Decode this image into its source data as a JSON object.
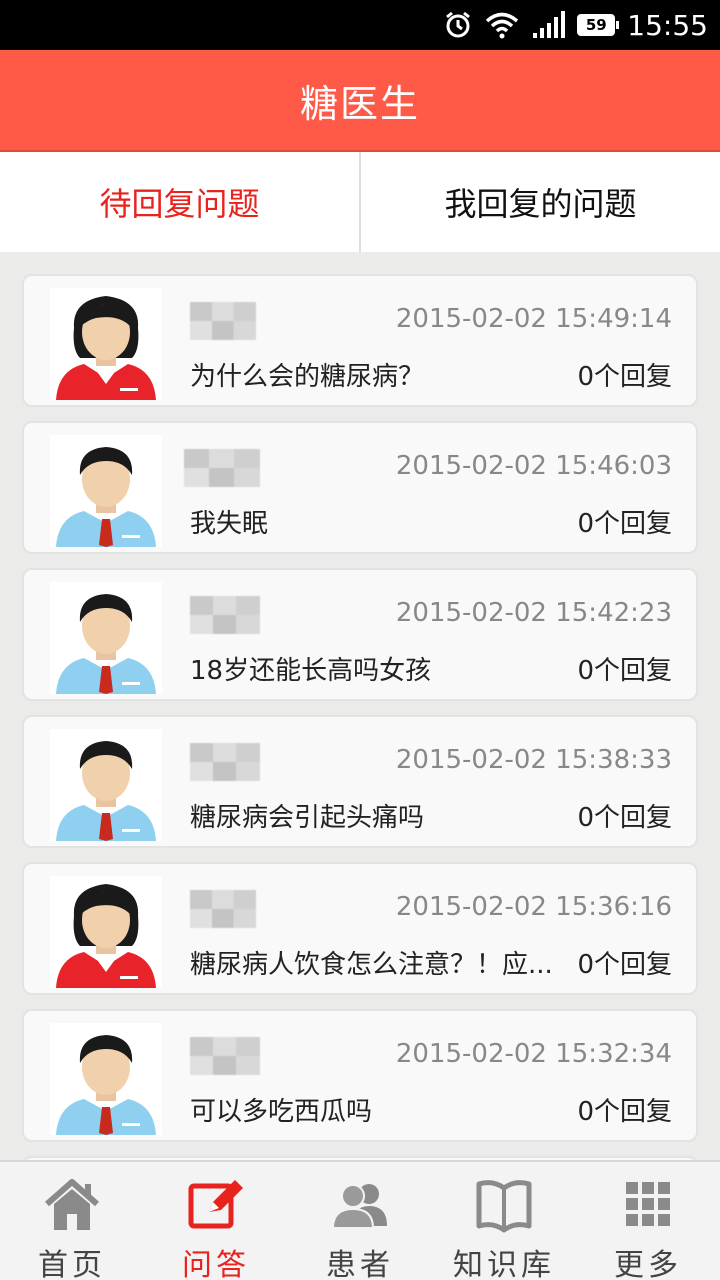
{
  "status_bar": {
    "time": "15:55",
    "battery": "59",
    "icons": [
      "alarm-icon",
      "wifi-icon",
      "signal-icon",
      "battery-icon"
    ]
  },
  "header": {
    "title": "糖医生"
  },
  "tabs": [
    {
      "label": "待回复问题",
      "active": true
    },
    {
      "label": "我回复的问题",
      "active": false
    }
  ],
  "questions": [
    {
      "avatar": "female-avatar-icon",
      "time": "2015-02-02 15:49:14",
      "text": "为什么会的糖尿病？",
      "replies": "0个回复"
    },
    {
      "avatar": "male-avatar-icon",
      "time": "2015-02-02 15:46:03",
      "text": "我失眠",
      "replies": "0个回复"
    },
    {
      "avatar": "male-avatar-icon",
      "time": "2015-02-02 15:42:23",
      "text": "18岁还能长高吗女孩",
      "replies": "0个回复"
    },
    {
      "avatar": "male-avatar-icon",
      "time": "2015-02-02 15:38:33",
      "text": "糖尿病会引起头痛吗",
      "replies": "0个回复"
    },
    {
      "avatar": "female-avatar-icon",
      "time": "2015-02-02 15:36:16",
      "text": "糖尿病人饮食怎么注意？！应...",
      "replies": "0个回复"
    },
    {
      "avatar": "male-avatar-icon",
      "time": "2015-02-02 15:32:34",
      "text": "可以多吃西瓜吗",
      "replies": "0个回复"
    }
  ],
  "bottom_nav": [
    {
      "label": "首页",
      "icon": "home-icon",
      "active": false
    },
    {
      "label": "问答",
      "icon": "edit-icon",
      "active": true
    },
    {
      "label": "患者",
      "icon": "patients-icon",
      "active": false
    },
    {
      "label": "知识库",
      "icon": "book-icon",
      "active": false
    },
    {
      "label": "更多",
      "icon": "grid-icon",
      "active": false
    }
  ],
  "colors": {
    "header": "#ff5a48",
    "active": "#e8231e",
    "female_shirt": "#e8232a",
    "male_shirt": "#8fd0f0"
  }
}
